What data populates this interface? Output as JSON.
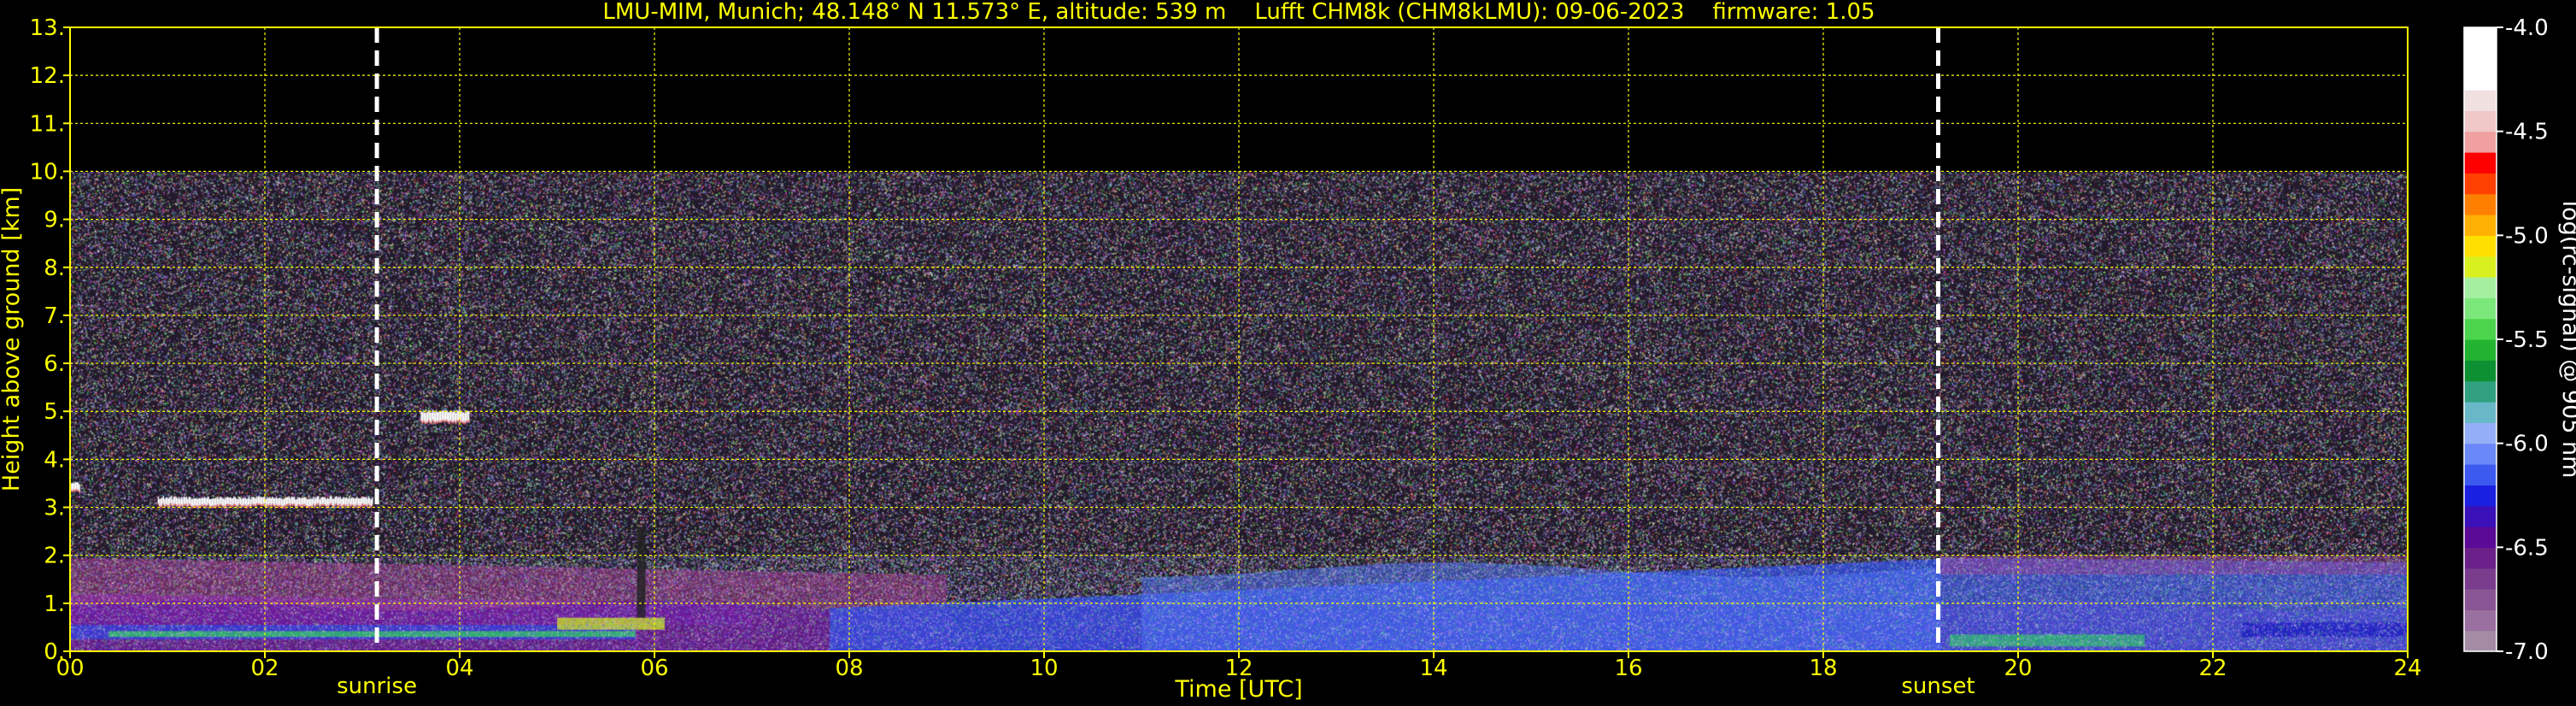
{
  "chart_data": {
    "type": "heatmap",
    "title": "LMU-MIM, Munich; 48.148° N 11.573° E, altitude: 539 m    Lufft CHM8k (CHM8kLMU): 09-06-2023    firmware: 1.05",
    "xlabel": "Time [UTC]",
    "ylabel": "Height above ground [km]",
    "xlim": [
      0,
      24
    ],
    "ylim": [
      0,
      13
    ],
    "x_ticks": [
      "00",
      "02",
      "04",
      "06",
      "08",
      "10",
      "12",
      "14",
      "16",
      "18",
      "20",
      "22",
      "24"
    ],
    "y_ticks": [
      "0.",
      "1.",
      "2.",
      "3.",
      "4.",
      "5.",
      "6.",
      "7.",
      "8.",
      "9.",
      "10.",
      "11.",
      "12.",
      "13."
    ],
    "grid": true,
    "grid_color": "#ffff00",
    "data_top_km": 10,
    "markers": [
      {
        "label": "sunrise",
        "x": 3.15
      },
      {
        "label": "sunset",
        "x": 19.18
      }
    ],
    "colorbar": {
      "label": "log(rc-signal) @ 905 nm",
      "range": [
        -7.0,
        -4.0
      ],
      "ticks": [
        "-4.0",
        "-4.5",
        "-5.0",
        "-5.5",
        "-6.0",
        "-6.5",
        "-7.0"
      ],
      "colors": [
        "#a48ca4",
        "#9a70a0",
        "#8a5594",
        "#7a3c8c",
        "#6a2088",
        "#5a0a96",
        "#3a10b8",
        "#1a20e0",
        "#3c5af0",
        "#6a88f8",
        "#95aef8",
        "#68b8c8",
        "#30a080",
        "#0c9032",
        "#22b430",
        "#4cd44c",
        "#7ce87c",
        "#a4f0a0",
        "#d8f020",
        "#ffe000",
        "#ffb000",
        "#ff8000",
        "#ff4000",
        "#ff0000",
        "#f0a0a0",
        "#f0c8c8",
        "#f0e0e0",
        "#ffffff",
        "#ffffff",
        "#ffffff"
      ]
    },
    "features": [
      {
        "name": "cloud",
        "x": [
          0.9,
          3.1
        ],
        "y": [
          3.05,
          3.2
        ],
        "intensity": -4.1
      },
      {
        "name": "cloud",
        "x": [
          3.6,
          4.1
        ],
        "y": [
          4.8,
          5.0
        ],
        "intensity": -4.2
      },
      {
        "name": "cloud",
        "x": [
          0.0,
          0.1
        ],
        "y": [
          3.35,
          3.5
        ],
        "intensity": -4.3
      },
      {
        "name": "boundary-layer",
        "x": [
          0,
          24
        ],
        "y": [
          0,
          2.0
        ],
        "intensity": -5.9
      }
    ]
  }
}
